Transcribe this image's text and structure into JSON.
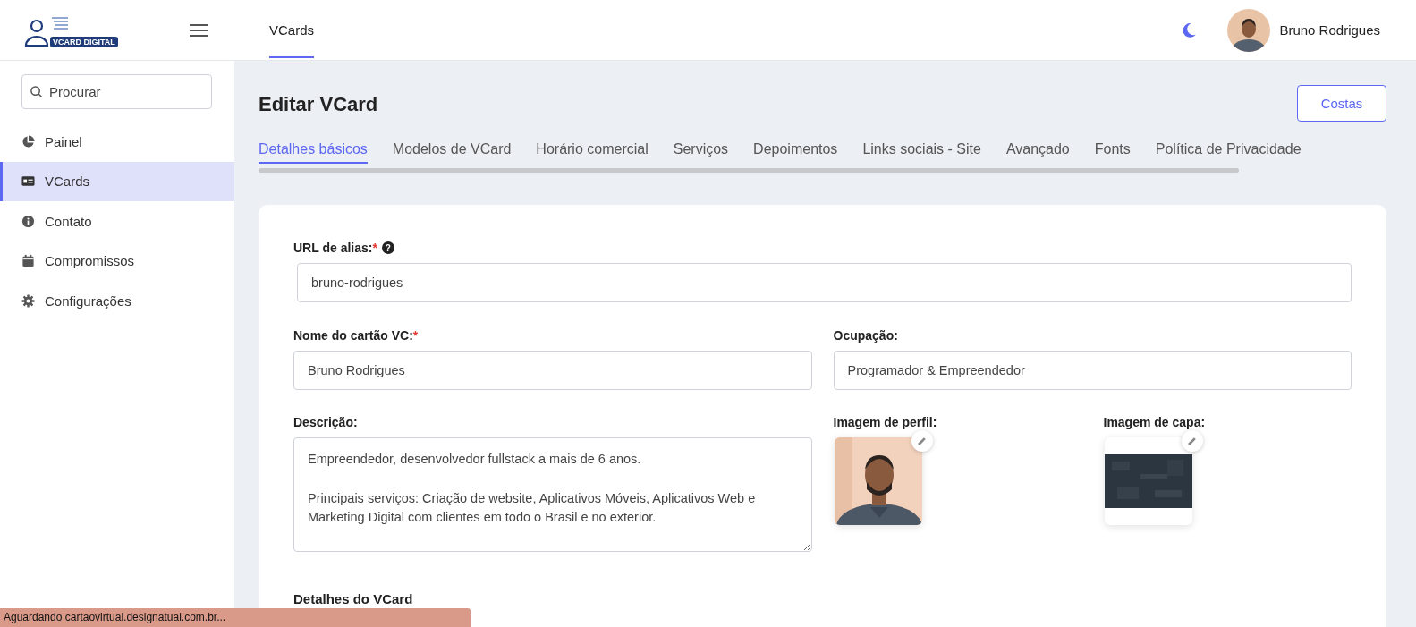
{
  "logo": {
    "badge": "VCARD DIGITAL"
  },
  "topnav": [
    {
      "label": "VCards",
      "selected": true
    }
  ],
  "user": {
    "name": "Bruno Rodrigues"
  },
  "sidebar": {
    "search": {
      "placeholder": "Procurar"
    },
    "items": [
      {
        "label": "Painel",
        "kind": "chart",
        "selected": false
      },
      {
        "label": "VCards",
        "kind": "card",
        "selected": true
      },
      {
        "label": "Contato",
        "kind": "info",
        "selected": false
      },
      {
        "label": "Compromissos",
        "kind": "calendar",
        "selected": false
      },
      {
        "label": "Configurações",
        "kind": "gear",
        "selected": false
      }
    ]
  },
  "page": {
    "title": "Editar VCard",
    "action": "Costas"
  },
  "tabs": [
    {
      "label": "Detalhes básicos",
      "selected": true
    },
    {
      "label": "Modelos de VCard",
      "selected": false
    },
    {
      "label": "Horário comercial",
      "selected": false
    },
    {
      "label": "Serviços",
      "selected": false
    },
    {
      "label": "Depoimentos",
      "selected": false
    },
    {
      "label": "Links sociais - Site",
      "selected": false
    },
    {
      "label": "Avançado",
      "selected": false
    },
    {
      "label": "Fonts",
      "selected": false
    },
    {
      "label": "Política de Privacidade",
      "selected": false
    }
  ],
  "form": {
    "alias": {
      "label": "URL de alias:",
      "required_mark": "*",
      "help": "?",
      "value": "bruno-rodrigues"
    },
    "name": {
      "label": "Nome do cartão VC:",
      "required_mark": "*",
      "value": "Bruno Rodrigues"
    },
    "occupation": {
      "label": "Ocupação:",
      "value": "Programador & Empreendedor"
    },
    "description": {
      "label": "Descrição:",
      "value": "Empreendedor, desenvolvedor fullstack a mais de 6 anos.\n\nPrincipais serviços: Criação de website, Aplicativos Móveis, Aplicativos Web e Marketing Digital com clientes em todo o Brasil e no exterior."
    },
    "profile_image": {
      "label": "Imagem de perfil:"
    },
    "cover_image": {
      "label": "Imagem de capa:"
    }
  },
  "section_heading": "Detalhes do VCard",
  "status_bar": "Aguardando cartaovirtual.designatual.com.br..."
}
